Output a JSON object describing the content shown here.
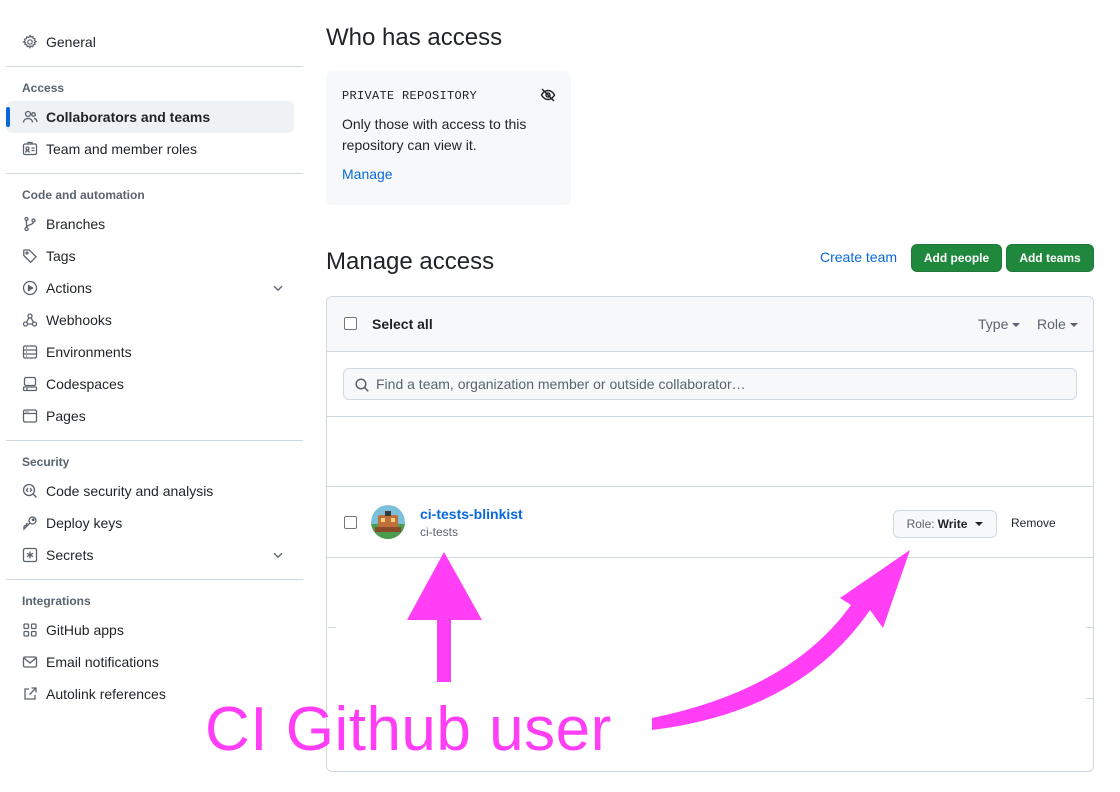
{
  "sidebar": {
    "general": {
      "label": "General",
      "icon": "gear-icon"
    },
    "groups": {
      "access": {
        "title": "Access",
        "items": [
          {
            "label": "Collaborators and teams",
            "icon": "people-icon",
            "active": true
          },
          {
            "label": "Team and member roles",
            "icon": "id-badge-icon"
          }
        ]
      },
      "code": {
        "title": "Code and automation",
        "items": [
          {
            "label": "Branches",
            "icon": "git-branch-icon"
          },
          {
            "label": "Tags",
            "icon": "tag-icon"
          },
          {
            "label": "Actions",
            "icon": "play-icon",
            "expandable": true
          },
          {
            "label": "Webhooks",
            "icon": "webhook-icon"
          },
          {
            "label": "Environments",
            "icon": "server-icon"
          },
          {
            "label": "Codespaces",
            "icon": "codespaces-icon"
          },
          {
            "label": "Pages",
            "icon": "browser-icon"
          }
        ]
      },
      "security": {
        "title": "Security",
        "items": [
          {
            "label": "Code security and analysis",
            "icon": "codescan-icon"
          },
          {
            "label": "Deploy keys",
            "icon": "key-icon"
          },
          {
            "label": "Secrets",
            "icon": "asterisk-icon",
            "expandable": true
          }
        ]
      },
      "integrations": {
        "title": "Integrations",
        "items": [
          {
            "label": "GitHub apps",
            "icon": "apps-icon"
          },
          {
            "label": "Email notifications",
            "icon": "mail-icon"
          },
          {
            "label": "Autolink references",
            "icon": "link-external-icon"
          }
        ]
      }
    }
  },
  "main": {
    "who_title": "Who has access",
    "private_box": {
      "label": "PRIVATE REPOSITORY",
      "icon": "eye-closed-icon",
      "text": "Only those with access to this repository can view it.",
      "link": "Manage"
    },
    "manage_title": "Manage access",
    "create_team": "Create team",
    "add_people": "Add people",
    "add_teams": "Add teams",
    "select_all": "Select all",
    "filters": {
      "type": "Type",
      "role": "Role"
    },
    "search": {
      "placeholder": "Find a team, organization member or outside collaborator…"
    },
    "members": [
      {
        "name": "ci-tests-blinkist",
        "sub": "ci-tests",
        "role_label": "Role:",
        "role_value": "Write",
        "remove": "Remove"
      }
    ]
  },
  "annotation": {
    "text": "CI Github user",
    "color": "#ff3ef6"
  },
  "colors": {
    "accent": "#0969da",
    "primary_button": "#1f883d",
    "annotation": "#ff3ef6"
  }
}
